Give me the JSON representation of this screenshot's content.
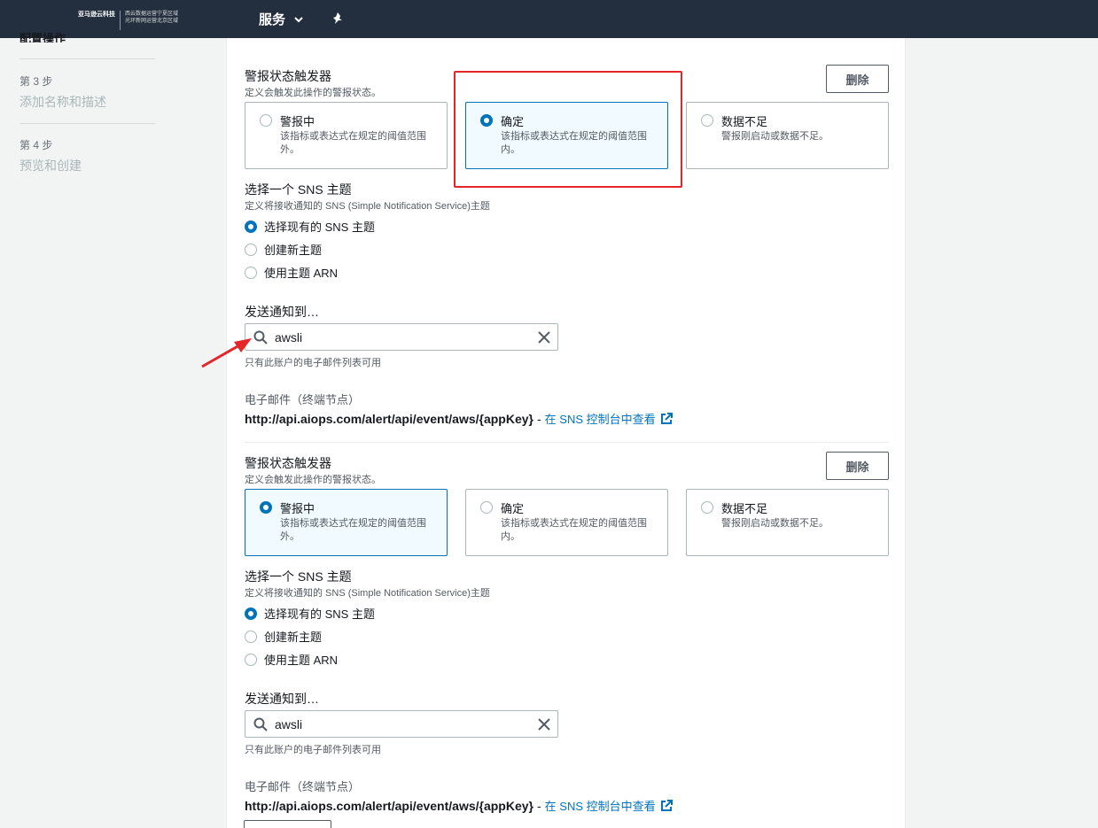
{
  "nav": {
    "brand": "亚马逊云科技",
    "region_line1": "西云数据运营宁夏区域",
    "region_line2": "光环新网运营北京区域",
    "services": "服务"
  },
  "sidebar": {
    "cut_label": "配置操作",
    "steps": [
      {
        "num": "第 3 步",
        "name": "添加名称和描述"
      },
      {
        "num": "第 4 步",
        "name": "预览和创建"
      }
    ]
  },
  "notifications": [
    {
      "trigger_label": "警报状态触发器",
      "trigger_desc": "定义会触发此操作的警报状态。",
      "remove_label": "删除",
      "states": [
        {
          "title": "警报中",
          "desc": "该指标或表达式在规定的阈值范围外。",
          "selected": false
        },
        {
          "title": "确定",
          "desc": "该指标或表达式在规定的阈值范围内。",
          "selected": true
        },
        {
          "title": "数据不足",
          "desc": "警报刚启动或数据不足。",
          "selected": false
        }
      ],
      "sns_label": "选择一个 SNS 主题",
      "sns_desc": "定义将接收通知的 SNS (Simple Notification Service)主题",
      "sns_options": [
        {
          "label": "选择现有的 SNS 主题",
          "selected": true
        },
        {
          "label": "创建新主题",
          "selected": false
        },
        {
          "label": "使用主题 ARN",
          "selected": false
        }
      ],
      "send_to_label": "发送通知到…",
      "search_value": "awsli",
      "search_hint": "只有此账户的电子邮件列表可用",
      "endpoint_label": "电子邮件（终端节点）",
      "endpoint_url": "http://api.aiops.com/alert/api/event/aws/{appKey}",
      "endpoint_dash": "-",
      "endpoint_link": "在 SNS 控制台中查看"
    },
    {
      "trigger_label": "警报状态触发器",
      "trigger_desc": "定义会触发此操作的警报状态。",
      "remove_label": "删除",
      "states": [
        {
          "title": "警报中",
          "desc": "该指标或表达式在规定的阈值范围外。",
          "selected": true
        },
        {
          "title": "确定",
          "desc": "该指标或表达式在规定的阈值范围内。",
          "selected": false
        },
        {
          "title": "数据不足",
          "desc": "警报刚启动或数据不足。",
          "selected": false
        }
      ],
      "sns_label": "选择一个 SNS 主题",
      "sns_desc": "定义将接收通知的 SNS (Simple Notification Service)主题",
      "sns_options": [
        {
          "label": "选择现有的 SNS 主题",
          "selected": true
        },
        {
          "label": "创建新主题",
          "selected": false
        },
        {
          "label": "使用主题 ARN",
          "selected": false
        }
      ],
      "send_to_label": "发送通知到…",
      "search_value": "awsli",
      "search_hint": "只有此账户的电子邮件列表可用",
      "endpoint_label": "电子邮件（终端节点）",
      "endpoint_url": "http://api.aiops.com/alert/api/event/aws/{appKey}",
      "endpoint_dash": "-",
      "endpoint_link": "在 SNS 控制台中查看"
    }
  ],
  "colors": {
    "accent": "#0073bb",
    "nav_bg": "#232f3e",
    "annotation": "#e4262a"
  },
  "icons": [
    "search-icon",
    "close-icon",
    "external-link-icon",
    "pin-icon",
    "chevron-down-icon"
  ]
}
